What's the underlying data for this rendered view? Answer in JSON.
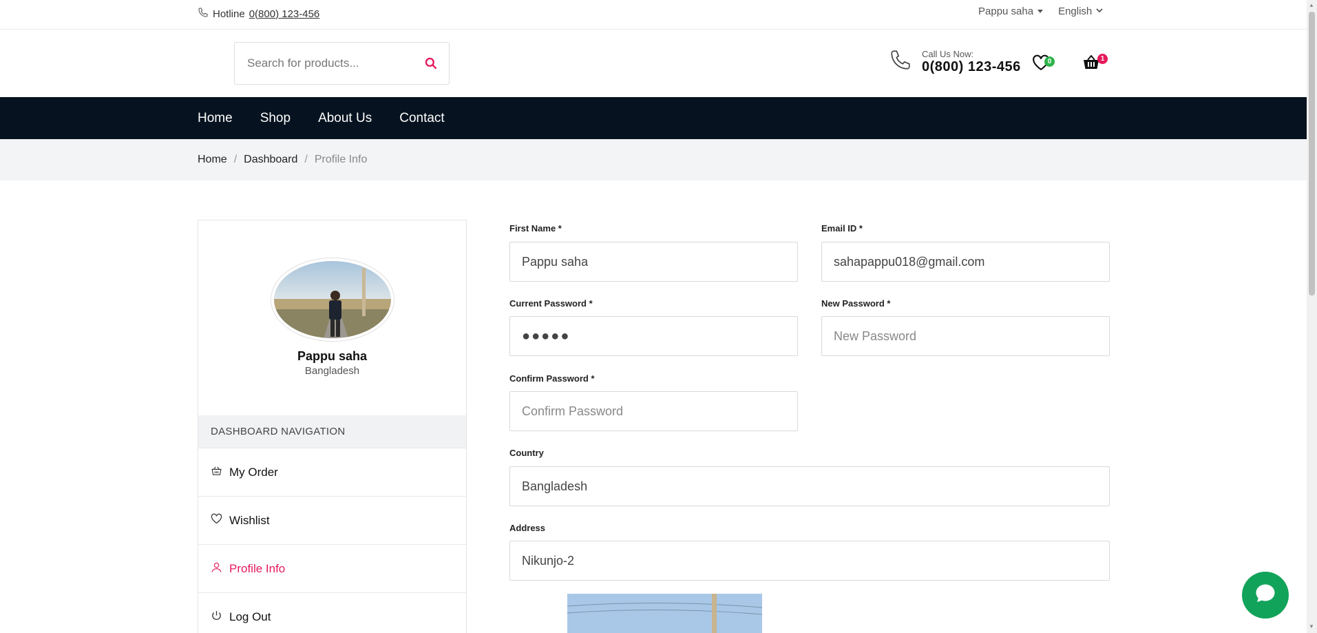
{
  "topbar": {
    "hotline_label": "Hotline",
    "hotline_number": "0(800) 123-456",
    "user": "Pappu saha",
    "language": "English"
  },
  "header": {
    "search_placeholder": "Search for products...",
    "call_label": "Call Us Now:",
    "call_number": "0(800) 123-456",
    "wishlist_count": "0",
    "cart_count": "1",
    "colors": {
      "accent": "#e5195b",
      "wishlist_badge": "#2db34a",
      "cart_badge": "#e5195b"
    }
  },
  "nav": {
    "items": [
      "Home",
      "Shop",
      "About Us",
      "Contact"
    ],
    "background": "#06121f"
  },
  "breadcrumb": {
    "home": "Home",
    "dashboard": "Dashboard",
    "current": "Profile Info"
  },
  "profile": {
    "name": "Pappu saha",
    "country": "Bangladesh"
  },
  "sidebar": {
    "heading": "DASHBOARD NAVIGATION",
    "items": [
      {
        "label": "My Order",
        "icon": "basket-icon"
      },
      {
        "label": "Wishlist",
        "icon": "heart-icon"
      },
      {
        "label": "Profile Info",
        "icon": "user-icon",
        "active": true
      },
      {
        "label": "Log Out",
        "icon": "power-icon"
      }
    ]
  },
  "form": {
    "first_name_label": "First Name *",
    "first_name_value": "Pappu saha",
    "email_label": "Email ID *",
    "email_value": "sahapappu018@gmail.com",
    "current_password_label": "Current Password *",
    "current_password_value": "●●●●●",
    "new_password_label": "New Password *",
    "new_password_placeholder": "New Password",
    "confirm_password_label": "Confirm Password *",
    "confirm_password_placeholder": "Confirm Password",
    "country_label": "Country",
    "country_value": "Bangladesh",
    "address_label": "Address",
    "address_value": "Nikunjo-2"
  },
  "chat": {
    "color": "#12a35a",
    "icon": "chat-bubble-icon"
  }
}
